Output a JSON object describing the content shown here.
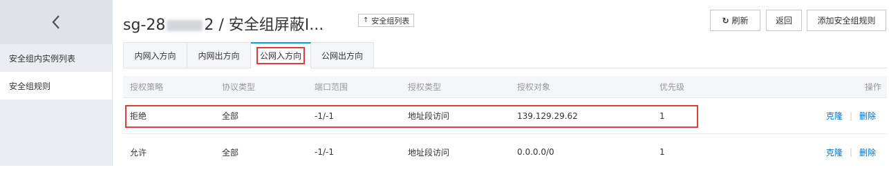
{
  "sidebar": {
    "items": [
      {
        "label": "安全组内实例列表"
      },
      {
        "label": "安全组规则"
      }
    ]
  },
  "header": {
    "title_prefix": "sg-28",
    "title_suffix": "2 / 安全组屏蔽I...",
    "back_list_label": "安全组列表",
    "refresh_label": "刷新",
    "back_label": "返回",
    "add_rule_label": "添加安全组规则"
  },
  "tabs": [
    {
      "label": "内网入方向"
    },
    {
      "label": "内网出方向"
    },
    {
      "label": "公网入方向"
    },
    {
      "label": "公网出方向"
    }
  ],
  "table": {
    "columns": [
      "授权策略",
      "协议类型",
      "端口范围",
      "授权类型",
      "授权对象",
      "优先级",
      "操作"
    ],
    "rows": [
      {
        "policy": "拒绝",
        "protocol": "全部",
        "port": "-1/-1",
        "auth_type": "地址段访问",
        "object": "139.129.29.62",
        "priority": "1",
        "clone": "克隆",
        "delete": "删除"
      },
      {
        "policy": "允许",
        "protocol": "全部",
        "port": "-1/-1",
        "auth_type": "地址段访问",
        "object": "0.0.0.0/0",
        "priority": "1",
        "clone": "克隆",
        "delete": "删除"
      }
    ]
  },
  "colors": {
    "accent": "#00a2ca",
    "link": "#0070cc",
    "highlight": "#e03a3e"
  }
}
